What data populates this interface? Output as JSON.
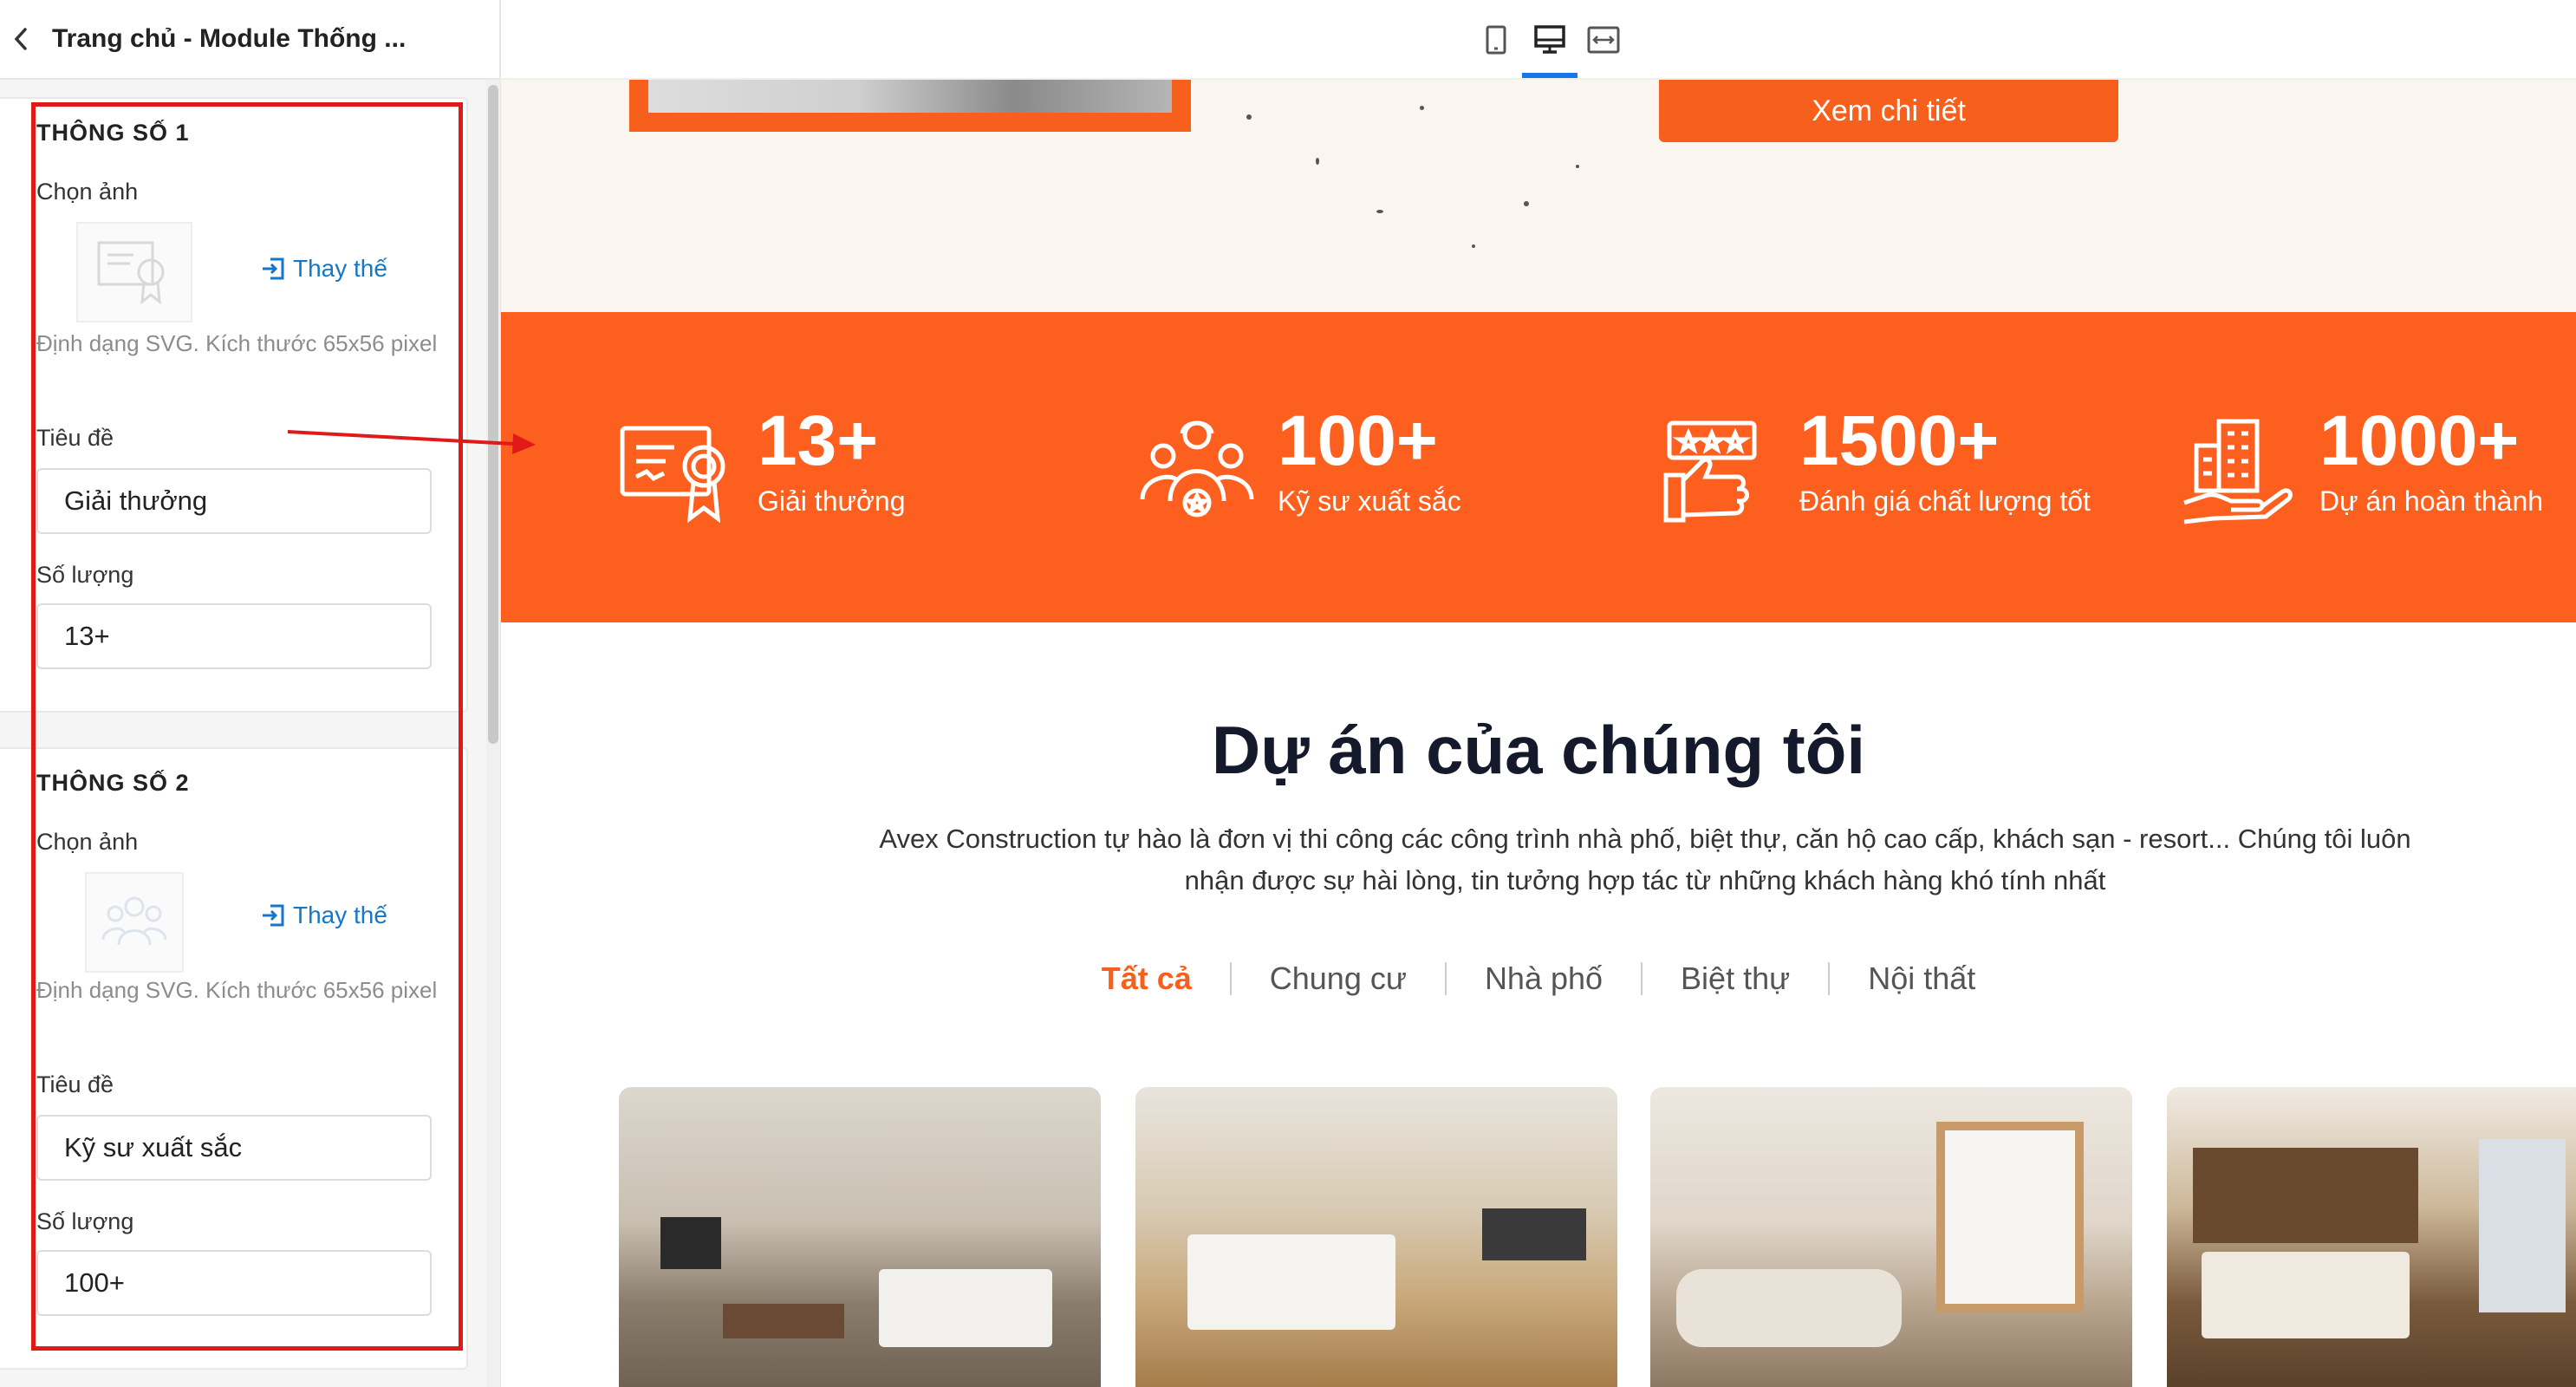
{
  "sidebar": {
    "title": "Trang chủ - Module Thống ...",
    "panels": [
      {
        "heading": "THÔNG SỐ 1",
        "image_label": "Chọn ảnh",
        "replace_label": "Thay thế",
        "hint": "Định dạng SVG. Kích thước 65x56 pixel",
        "title_label": "Tiêu đề",
        "title_value": "Giải thưởng",
        "count_label": "Số lượng",
        "count_value": "13+"
      },
      {
        "heading": "THÔNG SỐ 2",
        "image_label": "Chọn ảnh",
        "replace_label": "Thay thế",
        "hint": "Định dạng SVG. Kích thước 65x56 pixel",
        "title_label": "Tiêu đề",
        "title_value": "Kỹ sư xuất sắc",
        "count_label": "Số lượng",
        "count_value": "100+"
      }
    ]
  },
  "toolbar": {
    "devices": [
      "mobile-icon",
      "desktop-icon",
      "fullwidth-icon"
    ],
    "active_device": "desktop-icon"
  },
  "hero": {
    "button_label": "Xem chi tiết"
  },
  "stats": [
    {
      "icon": "certificate-icon",
      "number": "13+",
      "label": "Giải thưởng"
    },
    {
      "icon": "team-icon",
      "number": "100+",
      "label": "Kỹ sư xuất sắc"
    },
    {
      "icon": "rating-icon",
      "number": "1500+",
      "label": "Đánh giá chất lượng tốt"
    },
    {
      "icon": "building-hand-icon",
      "number": "1000+",
      "label": "Dự án hoàn thành"
    }
  ],
  "projects": {
    "title": "Dự án của chúng tôi",
    "description": "Avex Construction tự hào là đơn vị thi công các công trình nhà phố, biệt thự, căn hộ cao cấp, khách sạn - resort... Chúng tôi luôn nhận được sự hài lòng, tin tưởng hợp tác từ những khách hàng khó tính nhất",
    "filters": [
      "Tất cả",
      "Chung cư",
      "Nhà phố",
      "Biệt thự",
      "Nội thất"
    ],
    "active_filter": "Tất cả"
  },
  "colors": {
    "accent": "#fc5f1e",
    "link": "#1677c8",
    "highlight": "#e01919",
    "heading": "#141a2b"
  }
}
